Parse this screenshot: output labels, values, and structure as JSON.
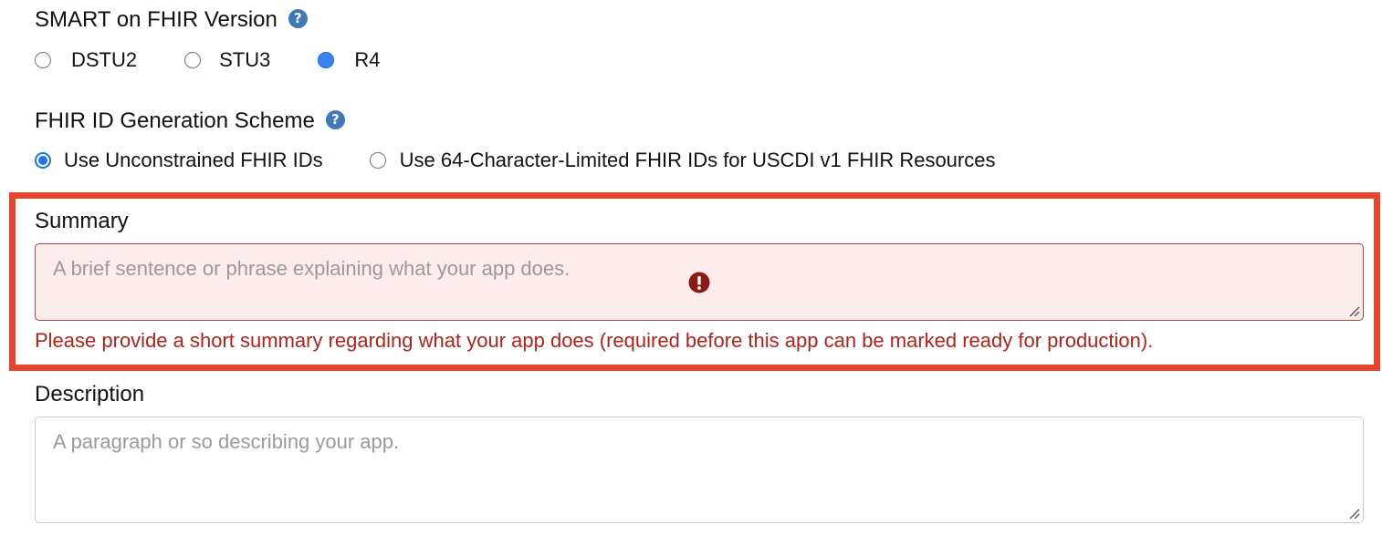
{
  "smart_version": {
    "label": "SMART on FHIR Version",
    "help_icon": "question-circle-icon",
    "options": [
      "DSTU2",
      "STU3",
      "R4"
    ],
    "selected": "R4"
  },
  "fhir_id_scheme": {
    "label": "FHIR ID Generation Scheme",
    "help_icon": "question-circle-icon",
    "options": [
      "Use Unconstrained FHIR IDs",
      "Use 64-Character-Limited FHIR IDs for USCDI v1 FHIR Resources"
    ],
    "selected": "Use Unconstrained FHIR IDs"
  },
  "summary": {
    "label": "Summary",
    "placeholder": "A brief sentence or phrase explaining what your app does.",
    "error_icon": "exclamation-circle-icon",
    "error_message": "Please provide a short summary regarding what your app does (required before this app can be marked ready for production)."
  },
  "description": {
    "label": "Description",
    "placeholder": "A paragraph or so describing your app."
  },
  "colors": {
    "highlight": "#e8432c",
    "error_text": "#b1221b",
    "error_bg": "#fcecec",
    "radio_selected": "#1a73e8",
    "help_icon": "#3d7ab7"
  }
}
